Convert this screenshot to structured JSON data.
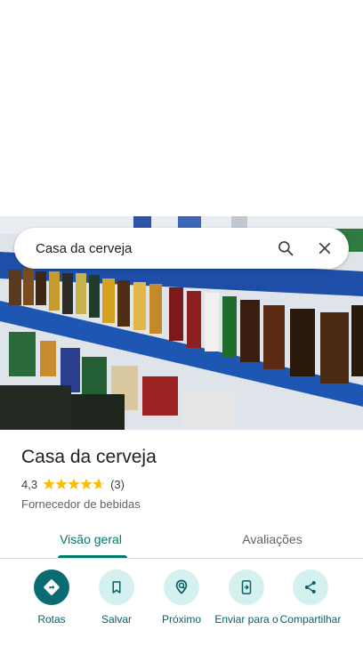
{
  "search": {
    "query": "Casa da cerveja",
    "search_icon": "search-icon",
    "close_icon": "close-icon"
  },
  "place": {
    "name": "Casa da cerveja",
    "rating": "4,3",
    "rating_value": 4.3,
    "review_count": "(3)",
    "category": "Fornecedor de bebidas"
  },
  "tabs": [
    {
      "label": "Visão geral",
      "active": true
    },
    {
      "label": "Avaliações",
      "active": false
    }
  ],
  "actions": [
    {
      "label": "Rotas",
      "icon": "directions-icon"
    },
    {
      "label": "Salvar",
      "icon": "bookmark-icon"
    },
    {
      "label": "Próximo",
      "icon": "nearby-icon"
    },
    {
      "label": "Enviar para o",
      "icon": "send-to-phone-icon"
    },
    {
      "label": "Compartilhar",
      "icon": "share-icon"
    }
  ],
  "colors": {
    "accent": "#00796b",
    "action_primary": "#0b6b73",
    "action_bg": "#d4f1ef",
    "star": "#fbbc04"
  }
}
